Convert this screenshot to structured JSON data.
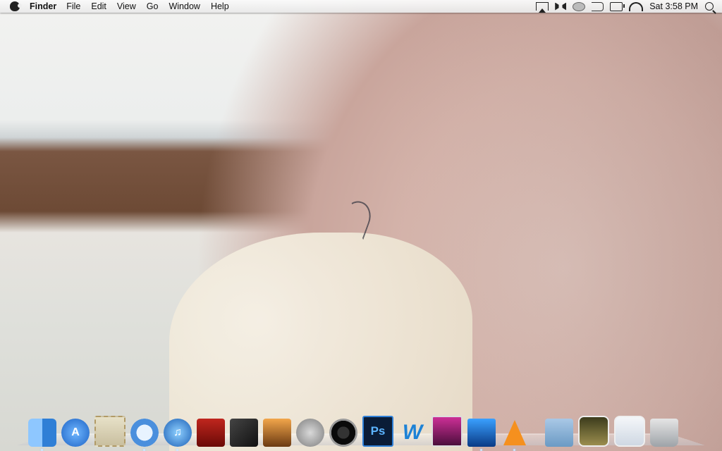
{
  "menubar": {
    "app_name": "Finder",
    "menus": [
      "File",
      "Edit",
      "View",
      "Go",
      "Window",
      "Help"
    ],
    "clock": "Sat 3:58 PM"
  },
  "dock": {
    "apps": [
      {
        "name": "Finder",
        "icon": "finder-icon",
        "running": true
      },
      {
        "name": "App Store",
        "icon": "appstore-icon",
        "running": false
      },
      {
        "name": "Mail",
        "icon": "mail-icon",
        "running": false
      },
      {
        "name": "Safari",
        "icon": "safari-icon",
        "running": true
      },
      {
        "name": "iTunes",
        "icon": "itunes-icon",
        "running": true
      },
      {
        "name": "Front Row",
        "icon": "frontrow-icon",
        "running": false
      },
      {
        "name": "Final Cut Pro",
        "icon": "finalcut-icon",
        "running": false
      },
      {
        "name": "iPhoto",
        "icon": "iphoto-icon",
        "running": false
      },
      {
        "name": "System Preferences",
        "icon": "sysprefs-icon",
        "running": false
      },
      {
        "name": "FaceTime",
        "icon": "facetime-icon",
        "running": false
      },
      {
        "name": "Photoshop",
        "icon": "photoshop-icon",
        "label": "Ps",
        "running": false
      },
      {
        "name": "Word",
        "icon": "word-icon",
        "label": "W",
        "running": false
      },
      {
        "name": "CleanMyMac",
        "icon": "cleanmymac-icon",
        "running": false
      },
      {
        "name": "Parallels",
        "icon": "parallels-icon",
        "running": true
      },
      {
        "name": "VLC",
        "icon": "vlc-icon",
        "running": true
      }
    ],
    "stacks": [
      {
        "name": "Applications",
        "icon": "folder-icon"
      },
      {
        "name": "Documents",
        "icon": "documents-stack-icon"
      },
      {
        "name": "Downloads",
        "icon": "downloads-stack-icon"
      },
      {
        "name": "Trash",
        "icon": "trash-icon"
      }
    ]
  }
}
